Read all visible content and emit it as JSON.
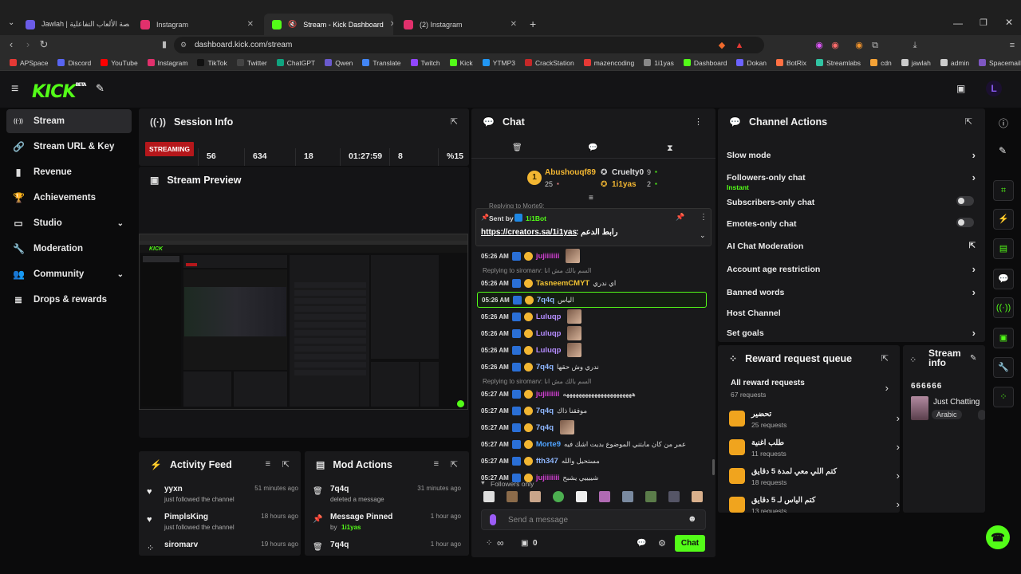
{
  "browser": {
    "tabs": [
      {
        "title": "Jawlah | جولة - منصة الألعاب التفاعلية",
        "active": false,
        "color": "#6b5ce7"
      },
      {
        "title": "Instagram",
        "active": false,
        "color": "#e1306c"
      },
      {
        "title": "Stream - Kick Dashboard",
        "active": true,
        "color": "#53fc18"
      },
      {
        "title": "(2) Instagram",
        "active": false,
        "color": "#e1306c"
      }
    ],
    "url": "dashboard.kick.com/stream",
    "bookmarks": [
      {
        "label": "APSpace",
        "color": "#e53935"
      },
      {
        "label": "Discord",
        "color": "#5865f2"
      },
      {
        "label": "YouTube",
        "color": "#ff0000"
      },
      {
        "label": "Instagram",
        "color": "#e1306c"
      },
      {
        "label": "TikTok",
        "color": "#111111"
      },
      {
        "label": "Twitter",
        "color": "#444444"
      },
      {
        "label": "ChatGPT",
        "color": "#10a37f"
      },
      {
        "label": "Qwen",
        "color": "#6a5acd"
      },
      {
        "label": "Translate",
        "color": "#4285f4"
      },
      {
        "label": "Twitch",
        "color": "#9146ff"
      },
      {
        "label": "Kick",
        "color": "#53fc18"
      },
      {
        "label": "YTMP3",
        "color": "#2196f3"
      },
      {
        "label": "CrackStation",
        "color": "#c62828"
      },
      {
        "label": "mazencoding",
        "color": "#e53935"
      },
      {
        "label": "1i1yas",
        "color": "#888888"
      },
      {
        "label": "Dashboard",
        "color": "#53fc18"
      },
      {
        "label": "Dokan",
        "color": "#6c63ff"
      },
      {
        "label": "BotRix",
        "color": "#ff7043"
      },
      {
        "label": "Streamlabs",
        "color": "#31c3a2"
      },
      {
        "label": "cdn",
        "color": "#f4a236"
      },
      {
        "label": "jawlah",
        "color": "#cccccc"
      },
      {
        "label": "admin",
        "color": "#cccccc"
      },
      {
        "label": "Spacemail",
        "color": "#7e57c2"
      }
    ]
  },
  "header": {
    "logo": "KICK",
    "logo_sup": "BETA"
  },
  "sidebar": {
    "items": [
      {
        "label": "Stream",
        "icon": "broadcast-icon",
        "glyph": "((·))",
        "active": true,
        "chevron": false
      },
      {
        "label": "Stream URL & Key",
        "icon": "link-icon",
        "glyph": "🔗",
        "active": false,
        "chevron": false
      },
      {
        "label": "Revenue",
        "icon": "chart-icon",
        "glyph": "▮",
        "active": false,
        "chevron": false
      },
      {
        "label": "Achievements",
        "icon": "trophy-icon",
        "glyph": "🏆",
        "active": false,
        "chevron": false
      },
      {
        "label": "Studio",
        "icon": "studio-icon",
        "glyph": "▭",
        "active": false,
        "chevron": true
      },
      {
        "label": "Moderation",
        "icon": "wrench-icon",
        "glyph": "🔧",
        "active": false,
        "chevron": false
      },
      {
        "label": "Community",
        "icon": "people-icon",
        "glyph": "👥",
        "active": false,
        "chevron": true
      },
      {
        "label": "Drops & rewards",
        "icon": "gift-icon",
        "glyph": "≣",
        "active": false,
        "chevron": false
      }
    ]
  },
  "session": {
    "title": "Session Info",
    "status": "STREAMING",
    "stats": [
      "56",
      "634",
      "18",
      "01:27:59",
      "8",
      "%15"
    ]
  },
  "preview": {
    "title": "Stream Preview"
  },
  "activity": {
    "title": "Activity Feed",
    "items": [
      {
        "name": "yyxn",
        "desc": "just followed the channel",
        "time": "51 minutes ago",
        "icon": "heart-icon",
        "glyph": "♥"
      },
      {
        "name": "PimplsKing",
        "desc": "just followed the channel",
        "time": "18 hours ago",
        "icon": "heart-icon",
        "glyph": "♥"
      },
      {
        "name": "siromarv",
        "desc": "",
        "time": "19 hours ago",
        "icon": "people-icon",
        "glyph": "⁘"
      }
    ]
  },
  "modactions": {
    "title": "Mod Actions",
    "items": [
      {
        "name": "7q4q",
        "desc": "deleted a message",
        "by": "",
        "time": "31 minutes ago",
        "icon": "trash-icon",
        "glyph": "🗑"
      },
      {
        "name": "Message Pinned",
        "desc": "by",
        "by": "1i1yas",
        "time": "1 hour ago",
        "icon": "pin-icon",
        "glyph": "📌"
      },
      {
        "name": "7q4q",
        "desc": "",
        "by": "",
        "time": "1 hour ago",
        "icon": "trash-icon",
        "glyph": "🗑"
      }
    ]
  },
  "chat": {
    "title": "Chat",
    "top": [
      {
        "name": "Abushouqf89",
        "count": "25",
        "color": "#f2b632"
      },
      {
        "name": "Cruelty0",
        "count": "9",
        "color": "#dddddd"
      },
      {
        "name": "1i1yas",
        "count": "2",
        "color": "#f2b632"
      }
    ],
    "pinned": {
      "sent_by_label": "Sent by",
      "sender": "1i1Bot",
      "link": "https://creators.sa/1i1yas",
      "text": ": رابط الدعم"
    },
    "reply_top": "Replying to Morte9:",
    "messages": [
      {
        "time": "05:26 AM",
        "user": "jujiiiiiii",
        "color": "#d23fd2",
        "msg": ""
      },
      {
        "reply": "Replying to siromarv: السم بالك مش انا"
      },
      {
        "time": "05:26 AM",
        "user": "TasneemCMYT",
        "color": "#f1c232",
        "msg": "اي ندري"
      },
      {
        "time": "05:26 AM",
        "user": "7q4q",
        "color": "#8fb7ff",
        "msg": "الياس",
        "highlight": true
      },
      {
        "time": "05:26 AM",
        "user": "Luluqp",
        "color": "#b48cff",
        "msg": ""
      },
      {
        "time": "05:26 AM",
        "user": "Luluqp",
        "color": "#b48cff",
        "msg": ""
      },
      {
        "time": "05:26 AM",
        "user": "Luluqp",
        "color": "#b48cff",
        "msg": ""
      },
      {
        "time": "05:26 AM",
        "user": "7q4q",
        "color": "#8fb7ff",
        "msg": "ندري وش حقها"
      },
      {
        "reply": "Replying to siromarv: السم بالك مش انا"
      },
      {
        "time": "05:27 AM",
        "user": "jujiiiiiii",
        "color": "#d23fd2",
        "msg": "ههههههههههههههههههههههه"
      },
      {
        "time": "05:27 AM",
        "user": "7q4q",
        "color": "#8fb7ff",
        "msg": "موفقنا ذاك"
      },
      {
        "time": "05:27 AM",
        "user": "7q4q",
        "color": "#8fb7ff",
        "msg": ""
      },
      {
        "time": "05:27 AM",
        "user": "Morte9",
        "color": "#4fa3ff",
        "msg": "عمر من كان مابتني الموضوع بديت اشك فيه"
      },
      {
        "time": "05:27 AM",
        "user": "fth347",
        "color": "#8fb7ff",
        "msg": "مستحيل والله"
      },
      {
        "time": "05:27 AM",
        "user": "jujiiiiiii",
        "color": "#d23fd2",
        "msg": "شييييي يشبح"
      }
    ],
    "followers_only": "Followers only",
    "input_placeholder": "Send a message",
    "infinity": "∞",
    "zero": "0",
    "send_label": "Chat"
  },
  "actions": {
    "title": "Channel Actions",
    "items": [
      {
        "label": "Slow mode",
        "sub": "",
        "kind": "chevron"
      },
      {
        "label": "Followers-only chat",
        "sub": "Instant",
        "kind": "chevron"
      },
      {
        "label": "Subscribers-only chat",
        "sub": "",
        "kind": "toggle"
      },
      {
        "label": "Emotes-only chat",
        "sub": "",
        "kind": "toggle"
      },
      {
        "label": "AI Chat Moderation",
        "sub": "",
        "kind": "external"
      },
      {
        "label": "Account age restriction",
        "sub": "",
        "kind": "chevron"
      },
      {
        "label": "Banned words",
        "sub": "",
        "kind": "chevron"
      },
      {
        "label": "Host Channel",
        "sub": "",
        "kind": "none"
      },
      {
        "label": "Set goals",
        "sub": "",
        "kind": "chevron"
      }
    ]
  },
  "rewards": {
    "title": "Reward request queue",
    "all_label": "All reward requests",
    "all_count": "67 requests",
    "items": [
      {
        "label": "تحضير",
        "count": "25 requests"
      },
      {
        "label": "طلب اغنية",
        "count": "11 requests"
      },
      {
        "label": "كتم اللي معي لمدة 5 دقايق",
        "count": "18 requests"
      },
      {
        "label": "كتم الياس لـ 5 دقايق",
        "count": "13 requests"
      }
    ]
  },
  "streaminfo": {
    "title": "Stream info",
    "title_line": "666666",
    "category": "Just Chatting",
    "tag": "Arabic"
  },
  "accent": "#53fc18"
}
